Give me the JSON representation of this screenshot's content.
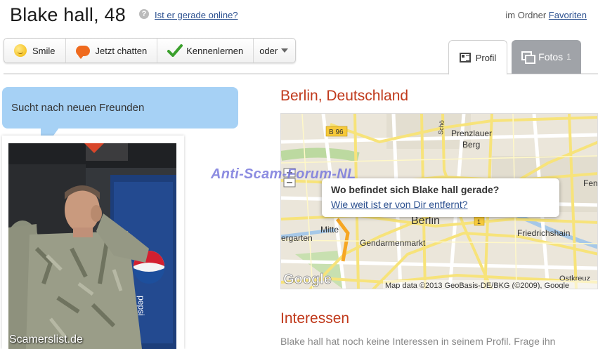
{
  "header": {
    "title": "Blake hall, 48",
    "help_icon_glyph": "?",
    "online_link": "Ist er gerade online?",
    "folder_prefix": "im Ordner",
    "folder_link": "Favoriten"
  },
  "actions": {
    "smile": "Smile",
    "chat": "Jetzt chatten",
    "meet": "Kennenlernen",
    "more": "oder"
  },
  "tabs": {
    "profile": "Profil",
    "photos": "Fotos",
    "photos_count": "1"
  },
  "bubble": {
    "text": "Sucht nach neuen Freunden"
  },
  "photo": {
    "watermark": "Scamerslist.de",
    "can_text": "pepsi"
  },
  "location": {
    "title": "Berlin, Deutschland"
  },
  "map": {
    "labels": {
      "b96": "B 96",
      "prenzlauer": "Prenzlauer",
      "berg": "Berg",
      "berlin": "Berlin",
      "mitte": "Mitte",
      "gendarmenmarkt": "Gendarmenmarkt",
      "friedrichshain": "Friedrichshain",
      "fennpfuhl": "Fennp",
      "garten": "ergarten",
      "ostkreuz": "Ostkreuz",
      "schonhauser": "Schö",
      "route1": "1",
      "google": "Google",
      "attribution": "Map data ©2013 GeoBasis-DE/BKG (©2009), Google"
    },
    "popup_question": "Wo befindet sich Blake hall gerade?",
    "popup_link": "Wie weit ist er von Dir entfernt?"
  },
  "watermark": "Anti-Scam-Forum-NL",
  "interests": {
    "title": "Interessen",
    "text": "Blake hall hat noch keine Interessen in seinem Profil. Frage ihn"
  },
  "colors": {
    "accent_red": "#c0391b",
    "link_blue": "#2a4f8f",
    "bubble_blue": "#a6d1f5",
    "tab_grey": "#a0a3a8"
  }
}
